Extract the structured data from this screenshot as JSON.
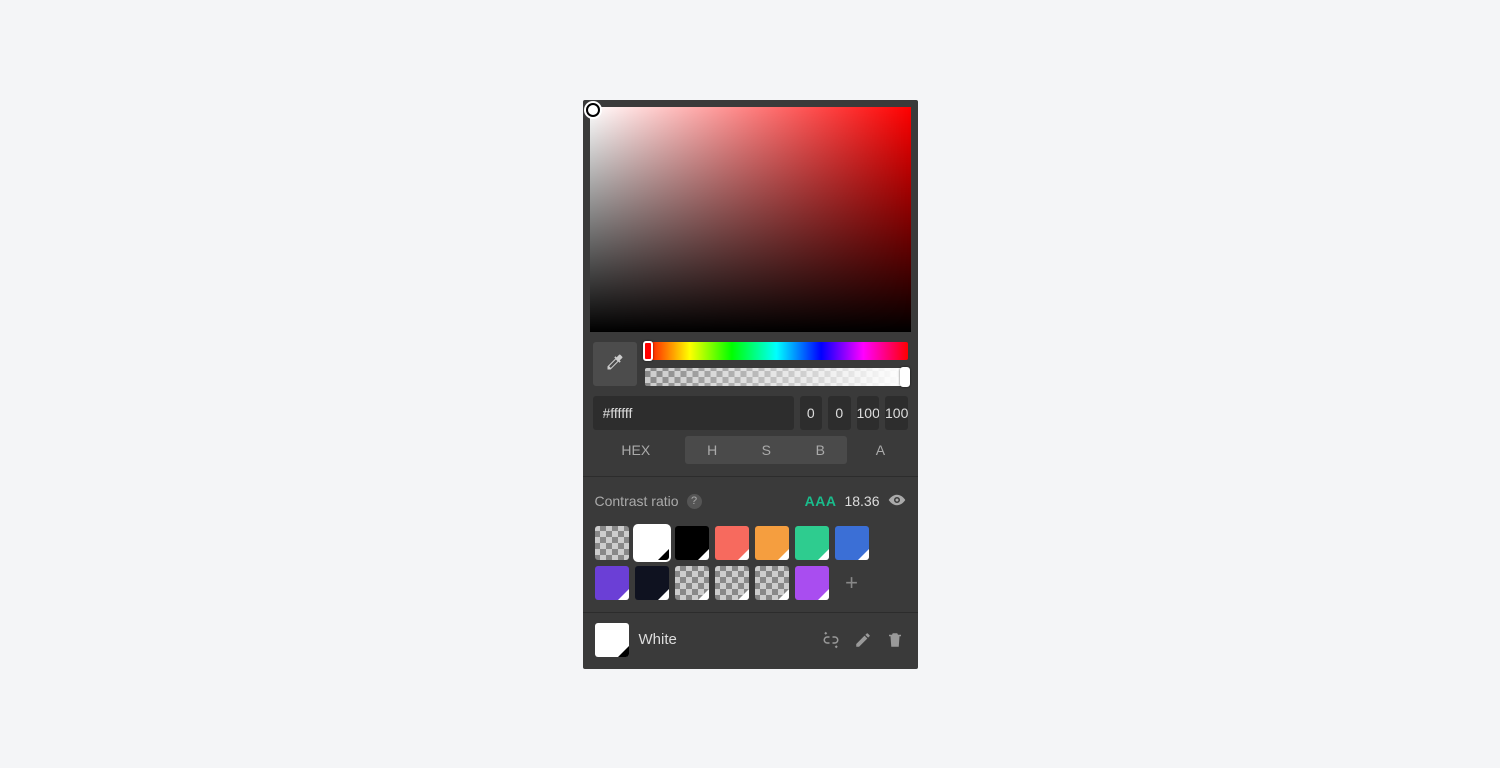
{
  "inputs": {
    "hex": "#ffffff",
    "h": "0",
    "s": "0",
    "b": "100",
    "a": "100"
  },
  "labels": {
    "hex": "HEX",
    "h": "H",
    "s": "S",
    "b": "B",
    "a": "A"
  },
  "contrast": {
    "label": "Contrast ratio",
    "rating": "AAA",
    "value": "18.36"
  },
  "swatches": [
    {
      "name": "transparent",
      "color": null,
      "transparent": true,
      "corner": false
    },
    {
      "name": "white",
      "color": "#ffffff",
      "selected": true,
      "corner": true,
      "cornerDark": true
    },
    {
      "name": "black",
      "color": "#000000",
      "corner": true
    },
    {
      "name": "coral",
      "color": "#f76a5e",
      "corner": true
    },
    {
      "name": "orange",
      "color": "#f59e3f",
      "corner": true
    },
    {
      "name": "green",
      "color": "#2ecc8f",
      "corner": true
    },
    {
      "name": "blue",
      "color": "#3b6fd6",
      "corner": true
    },
    {
      "name": "violet",
      "color": "#6b3fd6",
      "corner": true
    },
    {
      "name": "navy",
      "color": "#0f1220",
      "corner": true
    },
    {
      "name": "empty-1",
      "color": null,
      "transparent": true,
      "corner": true
    },
    {
      "name": "empty-2",
      "color": null,
      "transparent": true,
      "corner": true
    },
    {
      "name": "empty-3",
      "color": null,
      "transparent": true,
      "corner": true
    },
    {
      "name": "purple",
      "color": "#a94df0",
      "corner": true
    }
  ],
  "footer": {
    "colorName": "White",
    "swatchColor": "#ffffff"
  }
}
